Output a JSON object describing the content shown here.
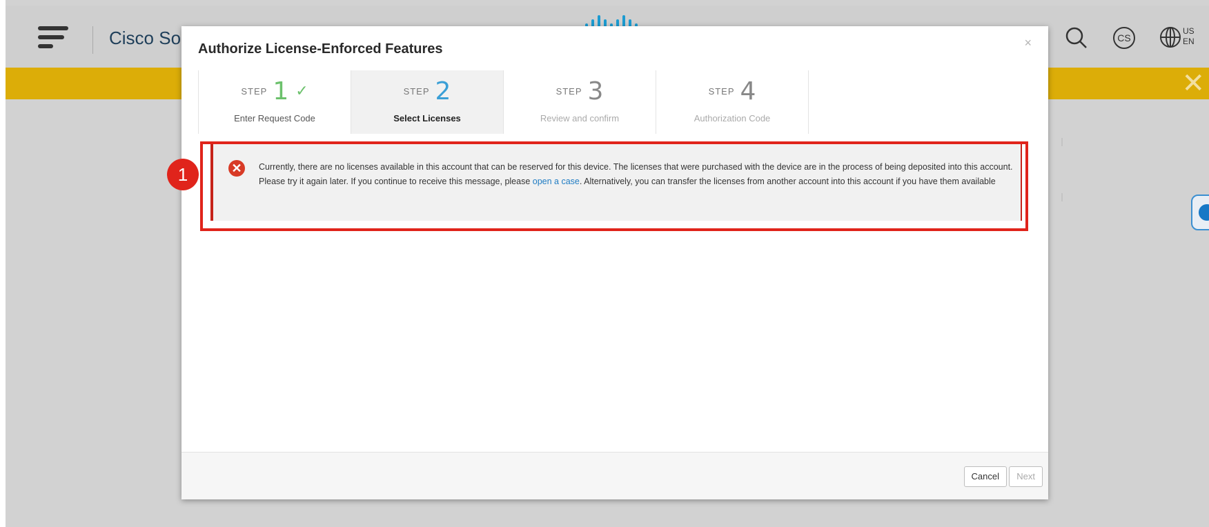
{
  "header": {
    "brand": "Cisco So",
    "locale_top": "US",
    "locale_bottom": "EN",
    "user_initials": "CS"
  },
  "dialog": {
    "title": "Authorize License-Enforced Features",
    "close": "×",
    "step_word": "STEP",
    "steps": [
      {
        "num": "1",
        "label": "Enter Request Code",
        "state": "complete"
      },
      {
        "num": "2",
        "label": "Select Licenses",
        "state": "active"
      },
      {
        "num": "3",
        "label": "Review and confirm",
        "state": "pending"
      },
      {
        "num": "4",
        "label": "Authorization Code",
        "state": "pending"
      }
    ],
    "alert": {
      "text_before": "Currently, there are no licenses available in this account that can be reserved for this device. The licenses that were purchased with the device are in the process of being deposited into this account. Please try it again later. If you continue to receive this message, please ",
      "link": "open a case",
      "text_after": ". Alternatively, you can transfer the licenses from another account into this account if you have them available"
    },
    "buttons": {
      "cancel": "Cancel",
      "next": "Next"
    }
  },
  "annotation": {
    "number": "1"
  },
  "colors": {
    "banner": "#dcad08",
    "error": "#d83a26",
    "annotation": "#e0241b",
    "step_complete": "#6cc16c",
    "step_active": "#3a9fd6",
    "link": "#1f7cc3"
  }
}
